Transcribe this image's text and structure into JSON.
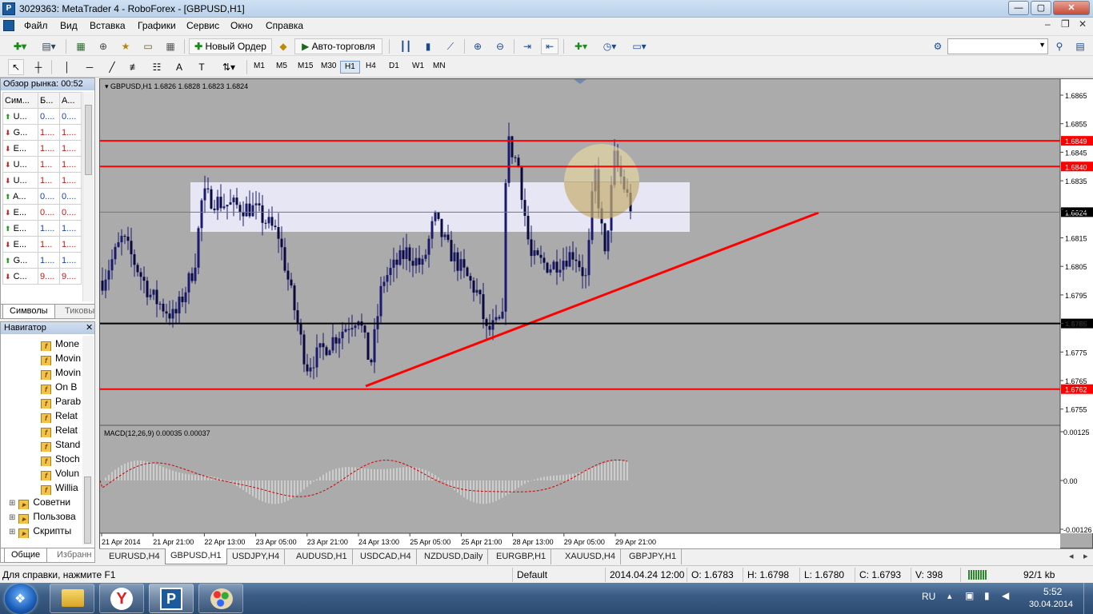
{
  "window": {
    "title": "3029363: MetaTrader 4 - RoboForex - [GBPUSD,H1]",
    "min": "—",
    "max": "▢",
    "close": "✕"
  },
  "menu": [
    "Файл",
    "Вид",
    "Вставка",
    "Графики",
    "Сервис",
    "Окно",
    "Справка"
  ],
  "toolbar": {
    "new_order": "Новый Ордер",
    "autotrade": "Авто-торговля"
  },
  "timeframes": [
    "M1",
    "M5",
    "M15",
    "M30",
    "H1",
    "H4",
    "D1",
    "W1",
    "MN"
  ],
  "selected_timeframe": "H1",
  "market_watch": {
    "title": "Обзор рынка: 00:52",
    "headers": [
      "Сим...",
      "Б...",
      "А..."
    ],
    "rows": [
      {
        "dir": "up",
        "sym": "U...",
        "bid": "0....",
        "ask": "0...."
      },
      {
        "dir": "dn",
        "sym": "G...",
        "bid": "1....",
        "ask": "1...."
      },
      {
        "dir": "dn",
        "sym": "E...",
        "bid": "1....",
        "ask": "1...."
      },
      {
        "dir": "dn",
        "sym": "U...",
        "bid": "1...",
        "ask": "1...."
      },
      {
        "dir": "dn",
        "sym": "U...",
        "bid": "1...",
        "ask": "1...."
      },
      {
        "dir": "up",
        "sym": "A...",
        "bid": "0....",
        "ask": "0...."
      },
      {
        "dir": "dn",
        "sym": "E...",
        "bid": "0....",
        "ask": "0...."
      },
      {
        "dir": "up",
        "sym": "E...",
        "bid": "1....",
        "ask": "1...."
      },
      {
        "dir": "dn",
        "sym": "E...",
        "bid": "1...",
        "ask": "1...."
      },
      {
        "dir": "up",
        "sym": "G...",
        "bid": "1....",
        "ask": "1...."
      },
      {
        "dir": "dn",
        "sym": "C...",
        "bid": "9....",
        "ask": "9...."
      }
    ],
    "tabs": [
      "Символы",
      "Тиковы"
    ]
  },
  "navigator": {
    "title": "Навигатор",
    "items": [
      "Mone",
      "Movin",
      "Movin",
      "On B",
      "Parab",
      "Relat",
      "Relat",
      "Stand",
      "Stoch",
      "Volun",
      "Willia"
    ],
    "groups": [
      "Советни",
      "Пользова",
      "Скрипты"
    ],
    "tabs": [
      "Общие",
      "Избранн"
    ]
  },
  "chart": {
    "header": "GBPUSD,H1  1.6826 1.6828 1.6823 1.6824",
    "macd_label": "MACD(12,26,9) 0.00035 0.00037",
    "price_labels": [
      "1.6865",
      "1.6855",
      "1.6845",
      "1.6835",
      "1.6825",
      "1.6815",
      "1.6805",
      "1.6795",
      "1.6785",
      "1.6775",
      "1.6765",
      "1.6755"
    ],
    "marked_levels": [
      {
        "price": "1.6849",
        "color": "#ff0000"
      },
      {
        "price": "1.6840",
        "color": "#ff0000"
      },
      {
        "price": "1.6824",
        "color": "#000000"
      },
      {
        "price": "1.6785",
        "color": "#000000"
      },
      {
        "price": "1.6762",
        "color": "#ff0000"
      }
    ],
    "macd_labels": [
      "0.00125",
      "0.00",
      "-0.00126"
    ],
    "time_labels": [
      "21 Apr 2014",
      "21 Apr 21:00",
      "22 Apr 13:00",
      "23 Apr 05:00",
      "23 Apr 21:00",
      "24 Apr 13:00",
      "25 Apr 05:00",
      "25 Apr 21:00",
      "28 Apr 13:00",
      "29 Apr 05:00",
      "29 Apr 21:00"
    ],
    "colors": {
      "bg": "#ababab",
      "candle": "#1a1a6e",
      "level": "#ff0000",
      "trend": "#ff0000",
      "zone": "#e6e6f5"
    }
  },
  "symbol_tabs": [
    "EURUSD,H4",
    "GBPUSD,H1",
    "USDJPY,H4",
    "AUDUSD,H1",
    "USDCAD,H4",
    "NZDUSD,Daily",
    "EURGBP,H1",
    "XAUUSD,H4",
    "GBPJPY,H1"
  ],
  "selected_symbol_tab": "GBPUSD,H1",
  "status": {
    "help": "Для справки, нажмите F1",
    "profile": "Default",
    "time": "2014.04.24 12:00",
    "open": "O: 1.6783",
    "high": "H: 1.6798",
    "low": "L: 1.6780",
    "close": "C: 1.6793",
    "volume": "V: 398",
    "traffic": "92/1 kb"
  },
  "taskbar": {
    "lang": "RU",
    "time": "5:52",
    "date": "30.04.2014"
  }
}
